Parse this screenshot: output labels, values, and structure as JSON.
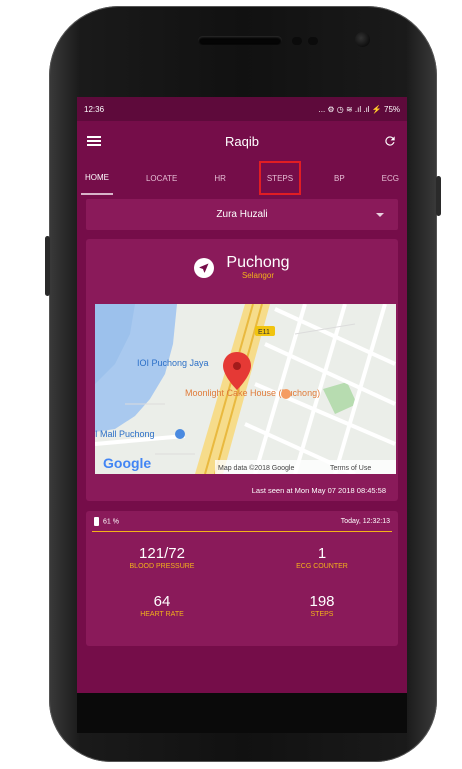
{
  "status_bar": {
    "time": "12:36",
    "indicators": "... ⚙ ◷ ≋ .ıl .ıl ⚡ 75%"
  },
  "app_bar": {
    "title": "Raqib",
    "menu_icon": "hamburger-menu-icon",
    "refresh_icon": "refresh-icon"
  },
  "tabs": [
    {
      "label": "HOME"
    },
    {
      "label": "LOCATE"
    },
    {
      "label": "HR"
    },
    {
      "label": "STEPS"
    },
    {
      "label": "BP"
    },
    {
      "label": "ECG"
    }
  ],
  "selected_tab": "HOME",
  "highlighted_tab": "STEPS",
  "patient_selector": {
    "value": "Zura Huzali"
  },
  "location": {
    "city": "Puchong",
    "state": "Selangor",
    "map": {
      "labels": {
        "ioi": "IOI Puchong Jaya",
        "moonlight": "Moonlight Cake House (Puchong)",
        "mall": "I Mall Puchong",
        "highway": "E11",
        "google": "Google",
        "map_data": "Map data ©2018 Google",
        "terms": "Terms of Use"
      }
    },
    "last_seen": "Last seen at Mon May 07 2018 08:45:58"
  },
  "stats": {
    "battery": "61 %",
    "updated": "Today, 12:32:13",
    "blood_pressure": {
      "value": "121/72",
      "label": "BLOOD PRESSURE"
    },
    "ecg_counter": {
      "value": "1",
      "label": "ECG COUNTER"
    },
    "heart_rate": {
      "value": "64",
      "label": "HEART RATE"
    },
    "steps": {
      "value": "198",
      "label": "STEPS"
    }
  },
  "colors": {
    "primary": "#750d49",
    "card": "#8a1a5a",
    "accent": "#f4b31a",
    "highlight": "#e11d23"
  }
}
